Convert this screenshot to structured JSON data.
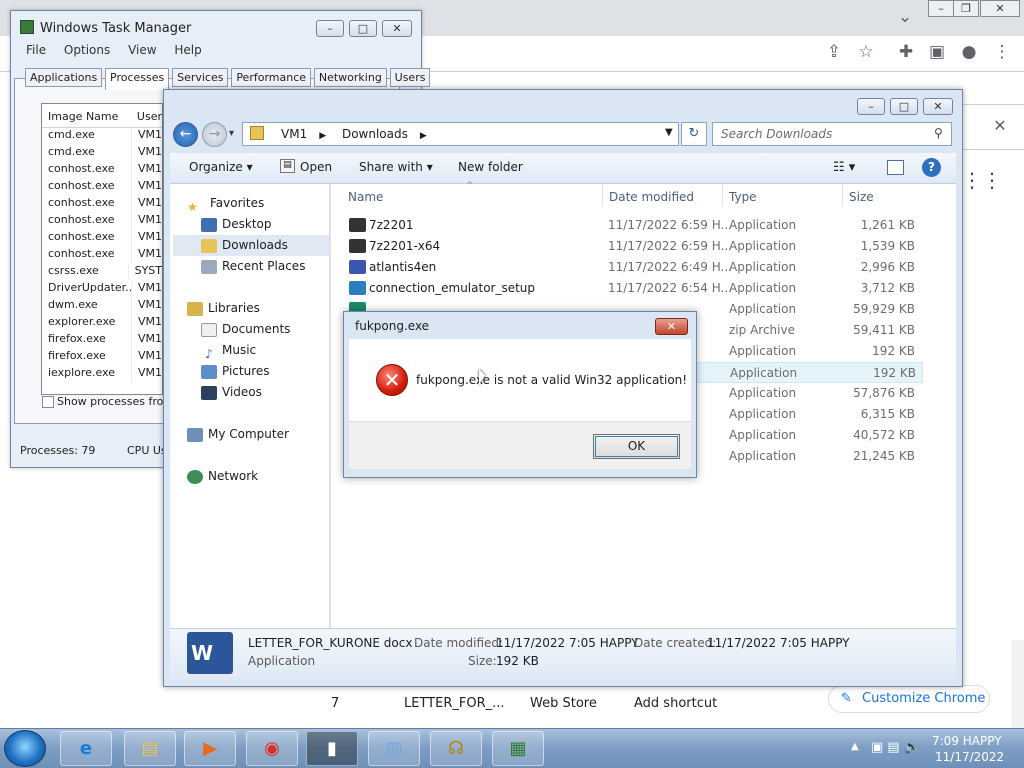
{
  "chrome": {
    "customize_label": "Customize Chrome",
    "shortcuts": [
      "7",
      "LETTER_FOR_...",
      "Web Store",
      "Add shortcut"
    ]
  },
  "task_manager": {
    "title": "Windows Task Manager",
    "menu": [
      "File",
      "Options",
      "View",
      "Help"
    ],
    "tabs": [
      "Applications",
      "Processes",
      "Services",
      "Performance",
      "Networking",
      "Users"
    ],
    "columns": [
      "Image Name",
      "User"
    ],
    "rows": [
      {
        "name": "cmd.exe",
        "user": "VM1"
      },
      {
        "name": "cmd.exe",
        "user": "VM1"
      },
      {
        "name": "conhost.exe",
        "user": "VM1"
      },
      {
        "name": "conhost.exe",
        "user": "VM1"
      },
      {
        "name": "conhost.exe",
        "user": "VM1"
      },
      {
        "name": "conhost.exe",
        "user": "VM1"
      },
      {
        "name": "conhost.exe",
        "user": "VM1"
      },
      {
        "name": "conhost.exe",
        "user": "VM1"
      },
      {
        "name": "csrss.exe",
        "user": "SYST"
      },
      {
        "name": "DriverUpdater....",
        "user": "VM1"
      },
      {
        "name": "dwm.exe",
        "user": "VM1"
      },
      {
        "name": "explorer.exe",
        "user": "VM1"
      },
      {
        "name": "firefox.exe",
        "user": "VM1"
      },
      {
        "name": "firefox.exe",
        "user": "VM1"
      },
      {
        "name": "iexplore.exe",
        "user": "VM1"
      }
    ],
    "show_processes": "Show processes from",
    "status_processes": "Processes: 79",
    "status_cpu": "CPU Us"
  },
  "explorer": {
    "breadcrumb": [
      "VM1",
      "Downloads"
    ],
    "search_placeholder": "Search Downloads",
    "commands": {
      "organize": "Organize",
      "open": "Open",
      "share": "Share with",
      "new_folder": "New folder"
    },
    "nav": {
      "favorites": "Favorites",
      "desktop": "Desktop",
      "downloads": "Downloads",
      "recent": "Recent Places",
      "libraries": "Libraries",
      "documents": "Documents",
      "music": "Music",
      "pictures": "Pictures",
      "videos": "Videos",
      "computer": "My Computer",
      "network": "Network"
    },
    "columns": {
      "name": "Name",
      "date": "Date modified",
      "type": "Type",
      "size": "Size"
    },
    "files": [
      {
        "name": "7z2201",
        "date": "11/17/2022 6:59 H...",
        "type": "Application",
        "size": "1,261 KB"
      },
      {
        "name": "7z2201-x64",
        "date": "11/17/2022 6:59 H...",
        "type": "Application",
        "size": "1,539 KB"
      },
      {
        "name": "atlantis4en",
        "date": "11/17/2022 6:49 H...",
        "type": "Application",
        "size": "2,996 KB"
      },
      {
        "name": "connection_emulator_setup",
        "date": "11/17/2022 6:54 H...",
        "type": "Application",
        "size": "3,712 KB"
      },
      {
        "name": "",
        "date": "",
        "type": "Application",
        "size": "59,929 KB"
      },
      {
        "name": "",
        "date": "",
        "type": "zip Archive",
        "size": "59,411 KB"
      },
      {
        "name": "",
        "date": "",
        "type": "Application",
        "size": "192 KB"
      },
      {
        "name": "",
        "date": "",
        "type": "Application",
        "size": "192 KB"
      },
      {
        "name": "",
        "date": "",
        "type": "Application",
        "size": "57,876 KB"
      },
      {
        "name": "",
        "date": "",
        "type": "Application",
        "size": "6,315 KB"
      },
      {
        "name": "",
        "date": "",
        "type": "Application",
        "size": "40,572 KB"
      },
      {
        "name": "",
        "date": "",
        "type": "Application",
        "size": "21,245 KB"
      }
    ],
    "details": {
      "filename": "LETTER_FOR_KURONE docx",
      "type": "Application",
      "modified_label": "Date modified:",
      "modified": "11/17/2022 7:05 HAPPY",
      "created_label": "Date created:",
      "created": "11/17/2022 7:05 HAPPY",
      "size_label": "Size:",
      "size": "192 KB"
    }
  },
  "dialog": {
    "title": "fukpong.exe",
    "message": "fukpong.exe is not a valid Win32 application!",
    "ok": "OK"
  },
  "taskbar": {
    "time": "7:09 HAPPY",
    "date": "11/17/2022"
  }
}
